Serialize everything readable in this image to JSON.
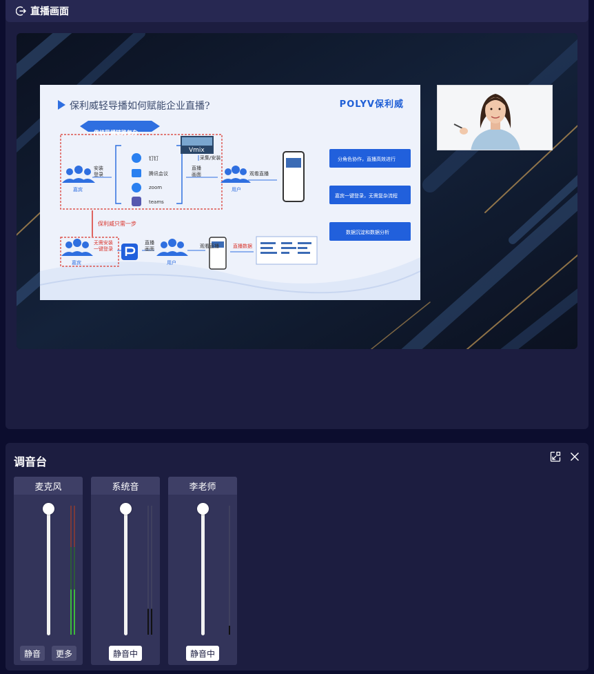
{
  "live": {
    "title": "直播画面",
    "slide": {
      "title": "保利威轻导播如何赋能企业直播?",
      "logo": "POLYV保利威",
      "banner": "传统导播链路复杂",
      "tools": [
        "钉钉",
        "腾讯会议",
        "zoom",
        "teams"
      ],
      "vmix": "Vmix",
      "guest": "嘉宾",
      "user": "用户",
      "install_login": "安装\n登录",
      "capture": "采集/安装",
      "live_view": "直播\n画面",
      "watch": "观看直播",
      "step_note": "保利威只需一步",
      "no_install": "无需安装\n一键登录",
      "live_data": "直播数据",
      "features": [
        "分角色协作，直播高效进行",
        "嘉宾一键登录，无需复杂流程",
        "数据沉淀和数据分析"
      ]
    }
  },
  "mixer": {
    "title": "调音台",
    "channels": [
      {
        "name": "麦克风",
        "buttons": [
          "静音",
          "更多"
        ],
        "level": 0.35
      },
      {
        "name": "系统音",
        "buttons": [
          "静音中"
        ],
        "level": 0.2
      },
      {
        "name": "李老师",
        "buttons": [
          "静音中"
        ],
        "level": 0.05
      }
    ]
  },
  "colors": {
    "accent": "#2f6fe0",
    "panel": "#1c1d40",
    "meter_green": "#3dbb3d"
  }
}
